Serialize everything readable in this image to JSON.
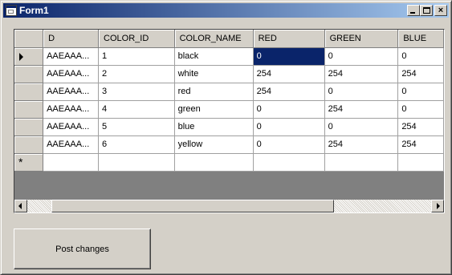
{
  "window": {
    "title": "Form1"
  },
  "titlebar_buttons": {
    "minimize": "minimize-icon",
    "maximize": "maximize-icon",
    "close": "×"
  },
  "grid": {
    "columns": [
      "D",
      "COLOR_ID",
      "COLOR_NAME",
      "RED",
      "GREEN",
      "BLUE"
    ],
    "rows": [
      [
        "AAEAAA...",
        "1",
        "black",
        "0",
        "0",
        "0"
      ],
      [
        "AAEAAA...",
        "2",
        "white",
        "254",
        "254",
        "254"
      ],
      [
        "AAEAAA...",
        "3",
        "red",
        "254",
        "0",
        "0"
      ],
      [
        "AAEAAA...",
        "4",
        "green",
        "0",
        "254",
        "0"
      ],
      [
        "AAEAAA...",
        "5",
        "blue",
        "0",
        "0",
        "254"
      ],
      [
        "AAEAAA...",
        "6",
        "yellow",
        "0",
        "254",
        "254"
      ]
    ],
    "current_row_marker": "arrow-icon",
    "new_row_marker": "*",
    "selected_cell": {
      "row": 0,
      "column": "RED"
    }
  },
  "scrollbar": {
    "position": 0.1
  },
  "buttons": {
    "post_changes": "Post changes"
  },
  "colors": {
    "titlebar": "#0a246a",
    "selection": "#0a246a",
    "face": "#d4d0c8"
  }
}
